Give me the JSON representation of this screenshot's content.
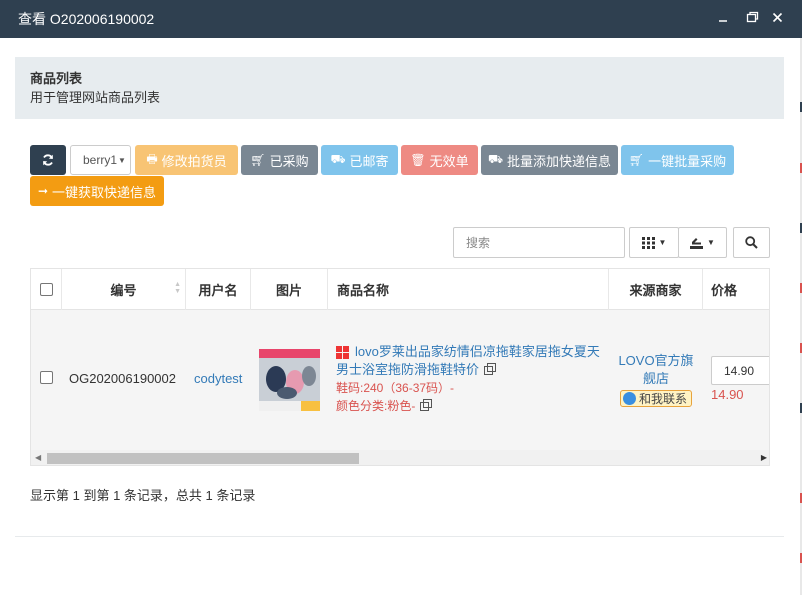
{
  "window": {
    "title": "查看 O202006190002"
  },
  "panel": {
    "title": "商品列表",
    "subtitle": "用于管理网站商品列表"
  },
  "toolbar": {
    "refresh_icon": "refresh-icon",
    "select_value": "berry1",
    "buttons": [
      {
        "label": "修改拍货员",
        "icon": "print-icon",
        "color": "#f8c474"
      },
      {
        "label": "已采购",
        "icon": "cart-icon",
        "color": "#7a8793"
      },
      {
        "label": "已邮寄",
        "icon": "truck-icon",
        "color": "#7fc4ec"
      },
      {
        "label": "无效单",
        "icon": "trash-icon",
        "color": "#ee8a83"
      },
      {
        "label": "批量添加快递信息",
        "icon": "truck-icon",
        "color": "#7a8793"
      },
      {
        "label": "一键批量采购",
        "icon": "cart-icon",
        "color": "#7fc4ec"
      },
      {
        "label": "一键获取快递信息",
        "icon": "arrow-right-icon",
        "color": "#f39c12"
      }
    ]
  },
  "search": {
    "placeholder": "搜索"
  },
  "table": {
    "headers": [
      "编号",
      "用户名",
      "图片",
      "商品名称",
      "来源商家",
      "价格"
    ],
    "rows": [
      {
        "id": "OG202006190002",
        "username": "codytest",
        "product_name": "lovo罗莱出品家纺情侣凉拖鞋家居拖女夏天男士浴室拖防滑拖鞋特价",
        "size": "鞋码:240（36-37码）-",
        "color": "颜色分类:粉色-",
        "merchant": "LOVO官方旗舰店",
        "contact_label": "和我联系",
        "price_input": "14.90",
        "price": "14.90"
      }
    ]
  },
  "footer": {
    "summary": "显示第 1 到第 1 条记录，总共 1 条记录"
  }
}
